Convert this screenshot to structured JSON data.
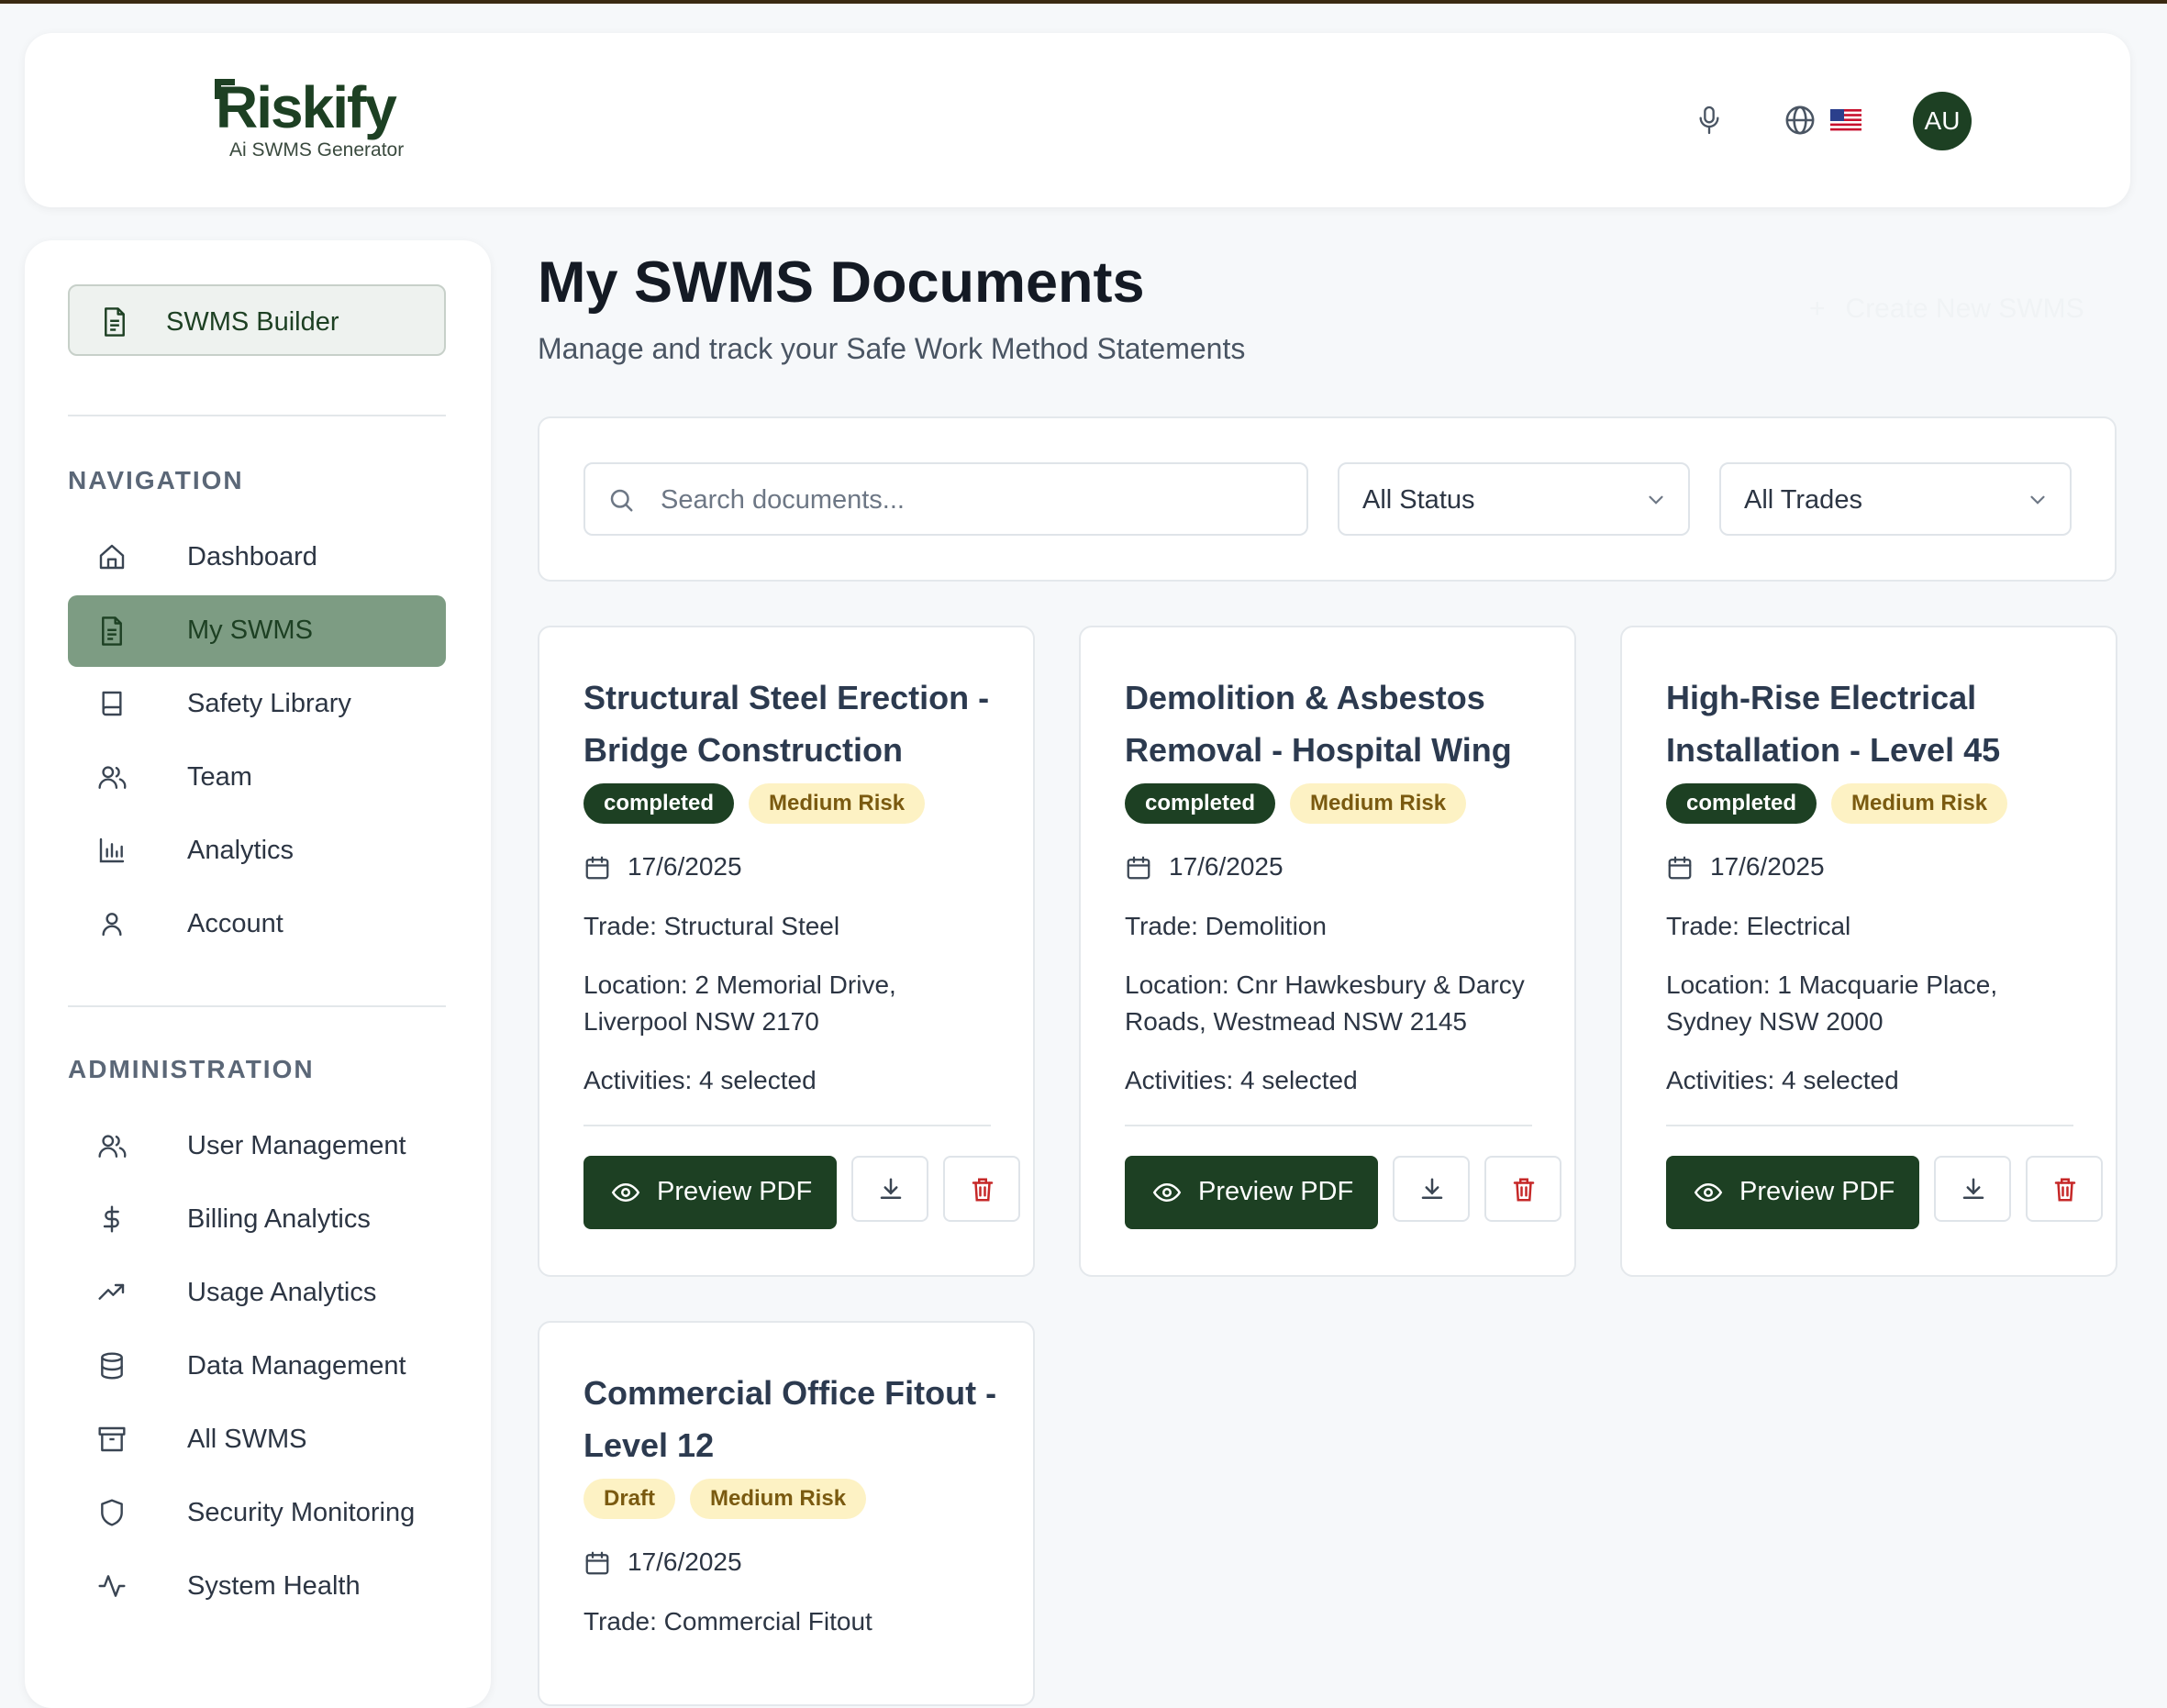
{
  "header": {
    "logo_text": "Riskify",
    "logo_subtitle": "Ai SWMS Generator",
    "avatar_initials": "AU",
    "flag": "🇺🇸"
  },
  "sidebar": {
    "builder_label": "SWMS Builder",
    "navigation_title": "NAVIGATION",
    "nav_items": [
      {
        "label": "Dashboard",
        "icon": "home-icon"
      },
      {
        "label": "My SWMS",
        "icon": "document-icon",
        "active": true
      },
      {
        "label": "Safety Library",
        "icon": "book-icon"
      },
      {
        "label": "Team",
        "icon": "users-icon"
      },
      {
        "label": "Analytics",
        "icon": "bar-chart-icon"
      },
      {
        "label": "Account",
        "icon": "user-icon"
      }
    ],
    "admin_title": "ADMINISTRATION",
    "admin_items": [
      {
        "label": "User Management",
        "icon": "users-icon"
      },
      {
        "label": "Billing Analytics",
        "icon": "dollar-icon"
      },
      {
        "label": "Usage Analytics",
        "icon": "trending-up-icon"
      },
      {
        "label": "Data Management",
        "icon": "database-icon"
      },
      {
        "label": "All SWMS",
        "icon": "archive-icon"
      },
      {
        "label": "Security Monitoring",
        "icon": "shield-icon"
      },
      {
        "label": "System Health",
        "icon": "activity-icon"
      }
    ]
  },
  "main": {
    "title": "My SWMS Documents",
    "subtitle": "Manage and track your Safe Work Method Statements",
    "create_label": "Create New SWMS",
    "search_placeholder": "Search documents...",
    "status_filter": "All Status",
    "trade_filter": "All Trades",
    "preview_label": "Preview PDF",
    "documents": [
      {
        "title": "Structural Steel Erection - Bridge Construction",
        "status": "completed",
        "risk": "Medium Risk",
        "date": "17/6/2025",
        "trade": "Trade: Structural Steel",
        "location": "Location: 2 Memorial Drive, Liverpool NSW 2170",
        "activities": "Activities: 4 selected"
      },
      {
        "title": "Demolition & Asbestos Removal - Hospital Wing",
        "status": "completed",
        "risk": "Medium Risk",
        "date": "17/6/2025",
        "trade": "Trade: Demolition",
        "location": "Location: Cnr Hawkesbury & Darcy Roads, Westmead NSW 2145",
        "activities": "Activities: 4 selected"
      },
      {
        "title": "High-Rise Electrical Installation - Level 45",
        "status": "completed",
        "risk": "Medium Risk",
        "date": "17/6/2025",
        "trade": "Trade: Electrical",
        "location": "Location: 1 Macquarie Place, Sydney NSW 2000",
        "activities": "Activities: 4 selected"
      },
      {
        "title": "Commercial Office Fitout - Level 12",
        "status": "Draft",
        "risk": "Medium Risk",
        "date": "17/6/2025",
        "trade": "Trade: Commercial Fitout"
      }
    ]
  },
  "colors": {
    "brand": "#1d4023",
    "active_nav": "#7d9c83",
    "badge_yellow": "#fdf2c4",
    "delete_red": "#c62828"
  }
}
